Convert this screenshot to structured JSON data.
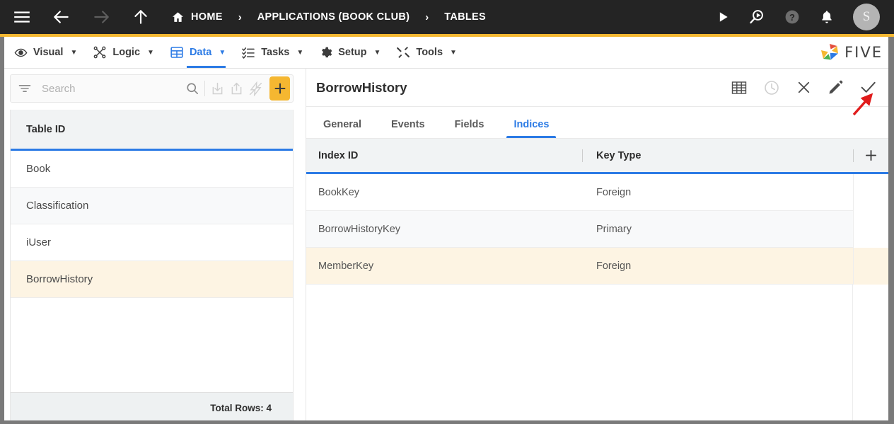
{
  "topbar": {
    "menu_icon": "hamburger-icon",
    "back_icon": "arrow-left-icon",
    "forward_icon": "arrow-right-icon",
    "up_icon": "arrow-up-icon",
    "home_icon": "home-icon",
    "breadcrumbs": [
      {
        "label": "HOME"
      },
      {
        "label": "APPLICATIONS (BOOK CLUB)"
      },
      {
        "label": "TABLES"
      }
    ],
    "separator": "›",
    "actions": [
      {
        "name": "run-icon",
        "label": ""
      },
      {
        "name": "debug-search-icon",
        "label": ""
      },
      {
        "name": "help-icon",
        "label": ""
      },
      {
        "name": "notifications-bell-icon",
        "label": ""
      }
    ],
    "avatar_initial": "S",
    "accent_color": "#F5B731",
    "background_color": "#242424"
  },
  "menubar": {
    "items": [
      {
        "label": "Visual",
        "icon": "eye-icon",
        "active": false
      },
      {
        "label": "Logic",
        "icon": "flow-icon",
        "active": false
      },
      {
        "label": "Data",
        "icon": "table-grid-icon",
        "active": true
      },
      {
        "label": "Tasks",
        "icon": "checklist-icon",
        "active": false
      },
      {
        "label": "Setup",
        "icon": "gear-icon",
        "active": false
      },
      {
        "label": "Tools",
        "icon": "tools-icon",
        "active": false
      }
    ],
    "caret": "▼",
    "brand": "FIVE",
    "active_color": "#2C7BE5"
  },
  "sidebar": {
    "search": {
      "placeholder": "Search",
      "value": ""
    },
    "toolbar": [
      {
        "name": "filter-icon",
        "disabled": false
      },
      {
        "name": "search-icon",
        "disabled": false
      },
      {
        "name": "import-icon",
        "disabled": true
      },
      {
        "name": "export-icon",
        "disabled": true
      },
      {
        "name": "lightning-disabled-icon",
        "disabled": true
      },
      {
        "name": "add-record-button",
        "disabled": false
      }
    ],
    "column_header": "Table ID",
    "rows": [
      {
        "label": "Book",
        "selected": false
      },
      {
        "label": "Classification",
        "selected": false
      },
      {
        "label": "iUser",
        "selected": false
      },
      {
        "label": "BorrowHistory",
        "selected": true
      }
    ],
    "footer": "Total Rows: 4",
    "selected_color": "#FDF4E3"
  },
  "main": {
    "title": "BorrowHistory",
    "header_actions": [
      {
        "name": "grid-view-icon",
        "disabled": false
      },
      {
        "name": "history-clock-icon",
        "disabled": true
      },
      {
        "name": "close-icon",
        "disabled": false
      },
      {
        "name": "edit-pencil-icon",
        "disabled": false
      },
      {
        "name": "save-check-icon",
        "disabled": false
      }
    ],
    "tabs": [
      {
        "label": "General",
        "active": false
      },
      {
        "label": "Events",
        "active": false
      },
      {
        "label": "Fields",
        "active": false
      },
      {
        "label": "Indices",
        "active": true
      }
    ],
    "grid": {
      "columns": [
        "Index ID",
        "Key Type"
      ],
      "add_icon": "plus-icon",
      "rows": [
        {
          "index_id": "BookKey",
          "key_type": "Foreign",
          "selected": false
        },
        {
          "index_id": "BorrowHistoryKey",
          "key_type": "Primary",
          "selected": false
        },
        {
          "index_id": "MemberKey",
          "key_type": "Foreign",
          "selected": true
        }
      ]
    }
  },
  "annotation": {
    "name": "red-arrow-pointer",
    "color": "#E01B1B",
    "points_to": "save-check-icon"
  }
}
